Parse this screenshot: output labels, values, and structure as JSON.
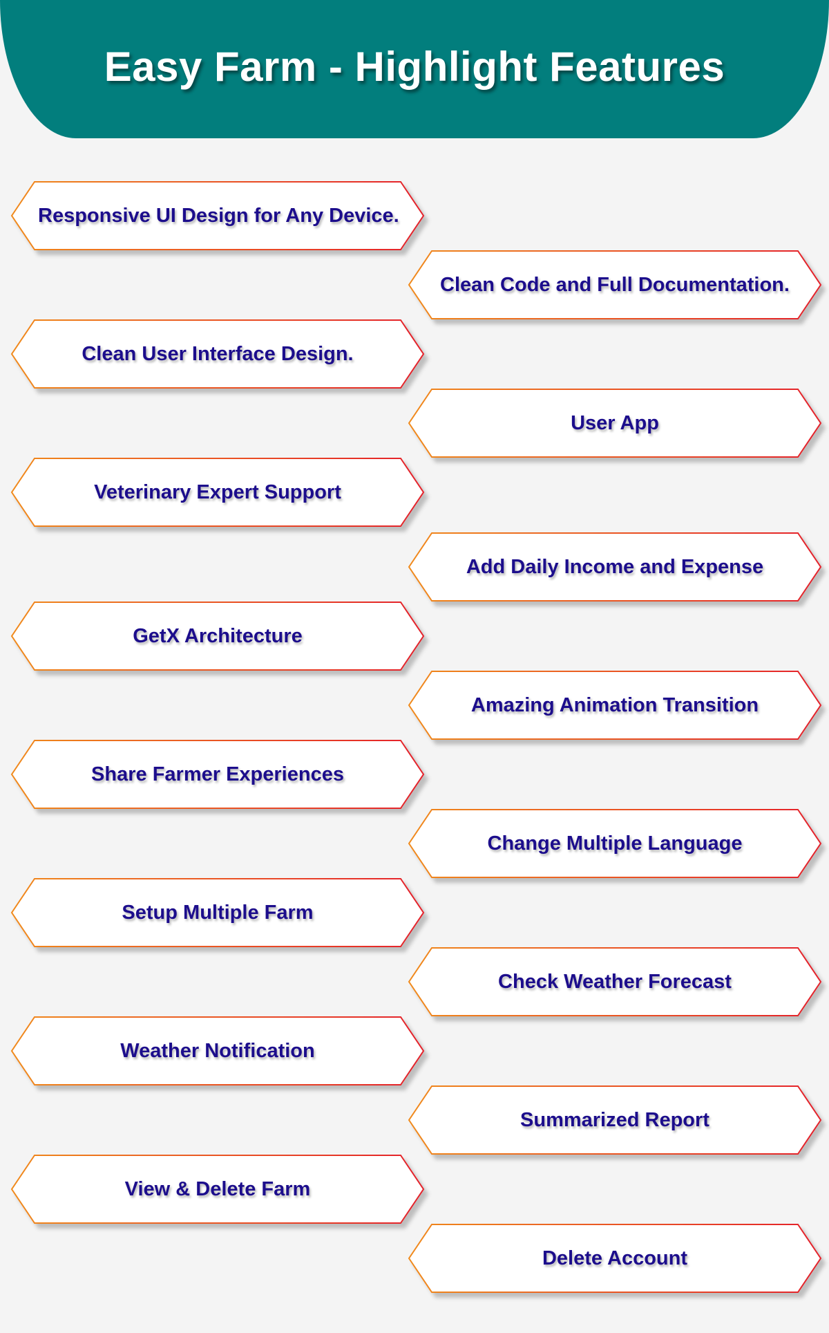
{
  "header": {
    "title": "Easy Farm - Highlight Features"
  },
  "colors": {
    "header_bg": "#027e7d",
    "page_bg": "#f4f4f4",
    "text": "#1c0d8c",
    "border_orange": "#f08a1c",
    "border_red": "#e4202a"
  },
  "features": [
    {
      "label": "Responsive UI Design for Any Device.",
      "side": "left"
    },
    {
      "label": "Clean Code and Full Documentation.",
      "side": "right"
    },
    {
      "label": "Clean User Interface Design.",
      "side": "left"
    },
    {
      "label": "User App",
      "side": "right"
    },
    {
      "label": "Veterinary Expert Support",
      "side": "left"
    },
    {
      "label": "Add Daily Income and Expense",
      "side": "right"
    },
    {
      "label": "GetX Architecture",
      "side": "left"
    },
    {
      "label": "Amazing Animation Transition",
      "side": "right"
    },
    {
      "label": "Share Farmer Experiences",
      "side": "left"
    },
    {
      "label": "Change Multiple Language",
      "side": "right"
    },
    {
      "label": "Setup Multiple Farm",
      "side": "left"
    },
    {
      "label": "Check Weather Forecast",
      "side": "right"
    },
    {
      "label": "Weather Notification",
      "side": "left"
    },
    {
      "label": "Summarized Report",
      "side": "right"
    },
    {
      "label": "View & Delete Farm",
      "side": "left"
    },
    {
      "label": "Delete Account",
      "side": "right"
    }
  ]
}
